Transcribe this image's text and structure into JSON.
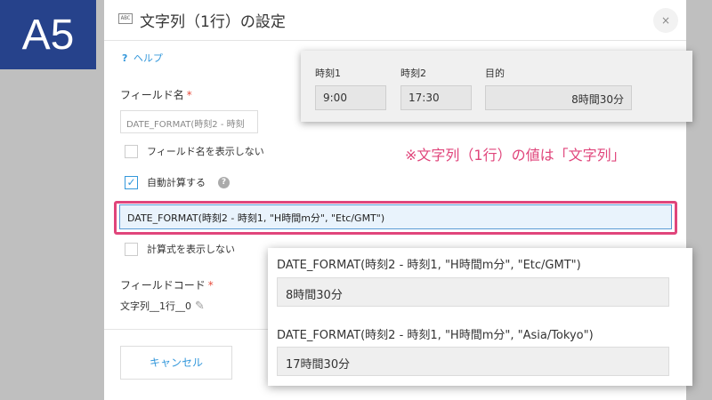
{
  "slide_label": "A5",
  "dialog": {
    "title_icon": "ABC",
    "title": "文字列（1行）の設定",
    "close_icon": "×",
    "help": {
      "icon": "?",
      "label": "ヘルプ"
    },
    "field_name": {
      "label": "フィールド名",
      "required_mark": "*",
      "value": "DATE_FORMAT(時刻2 - 時刻"
    },
    "hide_name": {
      "label": "フィールド名を表示しない",
      "checked": false
    },
    "auto_calc": {
      "label": "自動計算する",
      "checked": true,
      "check_mark": "✓",
      "help_icon": "?"
    },
    "formula": "DATE_FORMAT(時刻2 - 時刻1, \"H時間m分\", \"Etc/GMT\")",
    "hide_formula": {
      "label": "計算式を表示しない",
      "checked": false
    },
    "field_code": {
      "label": "フィールドコード",
      "required_mark": "*",
      "value": "文字列__1行__0",
      "edit_icon": "✎"
    },
    "cancel_label": "キャンセル"
  },
  "sample_record": {
    "fields": [
      {
        "label": "時刻1",
        "value": "9:00"
      },
      {
        "label": "時刻2",
        "value": "17:30"
      },
      {
        "label": "目的",
        "value": "8時間30分"
      }
    ]
  },
  "note": "※文字列（1行）の値は「文字列」",
  "examples": [
    {
      "formula": "DATE_FORMAT(時刻2 - 時刻1, \"H時間m分\", \"Etc/GMT\")",
      "result": "8時間30分"
    },
    {
      "formula": "DATE_FORMAT(時刻2 - 時刻1, \"H時間m分\", \"Asia/Tokyo\")",
      "result": "17時間30分"
    }
  ],
  "colors": {
    "accent": "#3498db",
    "highlight": "#e0457b",
    "label_bg": "#26428b"
  }
}
